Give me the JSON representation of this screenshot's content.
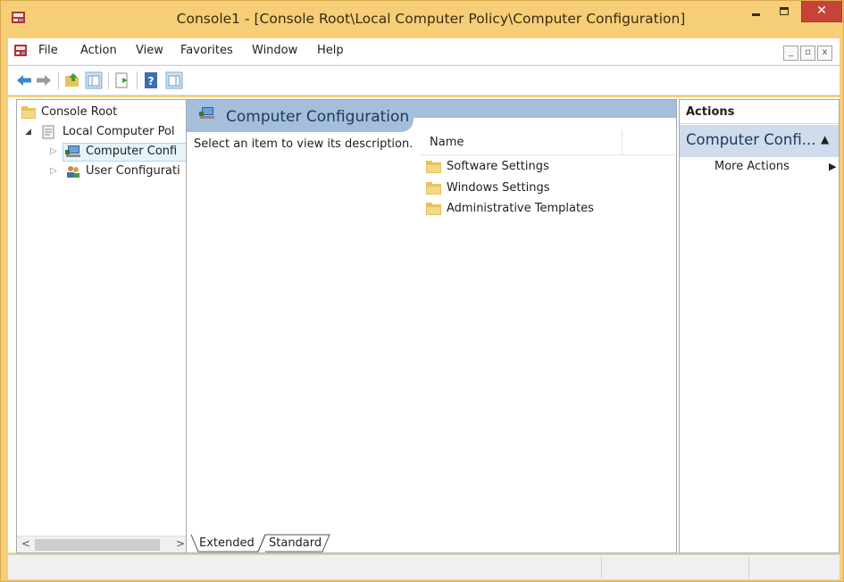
{
  "window": {
    "title": "Console1 - [Console Root\\Local Computer Policy\\Computer Configuration]",
    "minimize_icon": "minimize-icon",
    "maximize_icon": "maximize-icon",
    "close_glyph": "✕"
  },
  "menu": {
    "items": [
      "File",
      "Action",
      "View",
      "Favorites",
      "Window",
      "Help"
    ]
  },
  "toolbar": {
    "buttons": [
      "back-arrow-icon",
      "forward-arrow-icon",
      "up-folder-icon",
      "show-hide-tree-icon",
      "export-list-icon",
      "help-icon",
      "show-hide-action-pane-icon"
    ]
  },
  "tree": {
    "items": [
      {
        "label": "Console Root",
        "icon": "folder-icon"
      },
      {
        "label": "Local Computer Pol",
        "icon": "policy-document-icon",
        "expanded": true
      },
      {
        "label": "Computer Confi",
        "icon": "computer-config-icon",
        "selected": true
      },
      {
        "label": "User Configurati",
        "icon": "user-config-icon"
      }
    ],
    "scroll_left": "<",
    "scroll_right": ">"
  },
  "middle": {
    "header_title": "Computer Configuration",
    "description": "Select an item to view its description.",
    "column_name": "Name",
    "rows": [
      "Software Settings",
      "Windows Settings",
      "Administrative Templates"
    ],
    "tabs": [
      "Extended",
      "Standard"
    ]
  },
  "actions": {
    "heading": "Actions",
    "section_title": "Computer Confi...",
    "more_actions": "More Actions"
  },
  "colors": {
    "window_frame": "#f6ce78",
    "close_button": "#c7433a",
    "header_band": "#a4bedc",
    "actions_section": "#cfdcec"
  }
}
